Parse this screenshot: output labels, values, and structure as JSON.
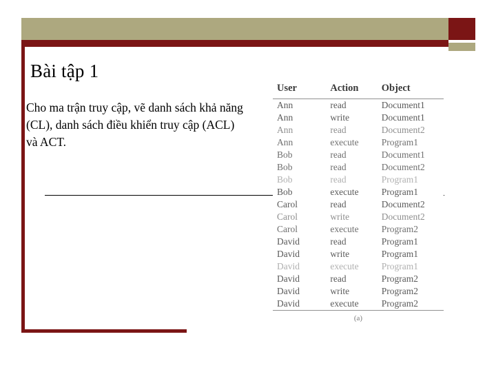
{
  "slide": {
    "title": "Bài tập 1",
    "body": "Cho ma trận truy cập, vẽ danh sách khả năng (CL),  danh sách điều khiển truy cập (ACL) và ACT.",
    "colors": {
      "accent_maroon": "#7b1515",
      "accent_olive": "#ada87f",
      "text": "#000000"
    }
  },
  "figure": {
    "caption": "(a)",
    "columns": [
      "User",
      "Action",
      "Object"
    ],
    "rows": [
      [
        "Ann",
        "read",
        "Document1"
      ],
      [
        "Ann",
        "write",
        "Document1"
      ],
      [
        "Ann",
        "read",
        "Document2"
      ],
      [
        "Ann",
        "execute",
        "Program1"
      ],
      [
        "Bob",
        "read",
        "Document1"
      ],
      [
        "Bob",
        "read",
        "Document2"
      ],
      [
        "Bob",
        "read",
        "Program1"
      ],
      [
        "Bob",
        "execute",
        "Program1"
      ],
      [
        "Carol",
        "read",
        "Document2"
      ],
      [
        "Carol",
        "write",
        "Document2"
      ],
      [
        "Carol",
        "execute",
        "Program2"
      ],
      [
        "David",
        "read",
        "Program1"
      ],
      [
        "David",
        "write",
        "Program1"
      ],
      [
        "David",
        "execute",
        "Program1"
      ],
      [
        "David",
        "read",
        "Program2"
      ],
      [
        "David",
        "write",
        "Program2"
      ],
      [
        "David",
        "execute",
        "Program2"
      ]
    ]
  }
}
